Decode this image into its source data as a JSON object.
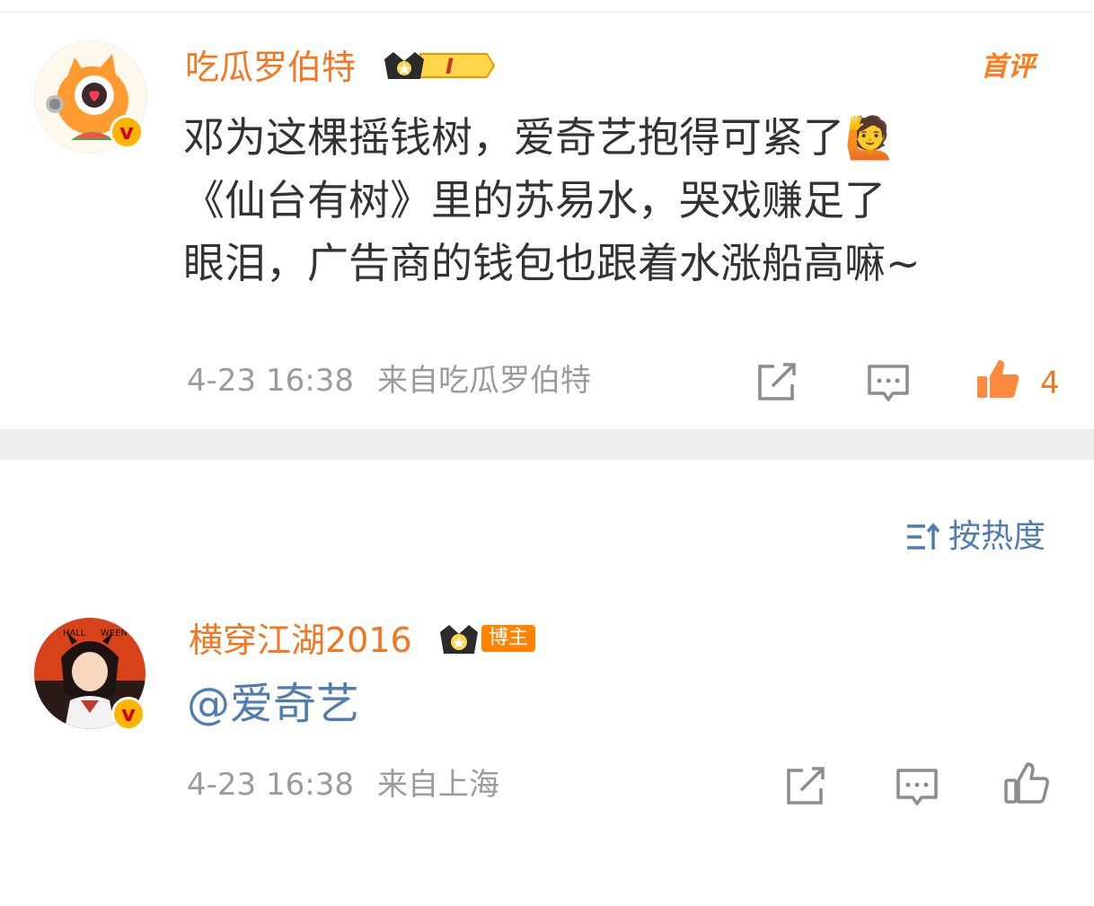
{
  "post": {
    "username": "吃瓜罗伯特",
    "level_badge": "I",
    "first_comment_badge": "首评",
    "content_lines": [
      "邓为这棵摇钱树，爱奇艺抱得可紧了🙋",
      "《仙台有树》里的苏易水，哭戏赚足了",
      "眼泪，广告商的钱包也跟着水涨船高嘛~"
    ],
    "timestamp": "4-23 16:38",
    "source": "来自吃瓜罗伯特",
    "like_count": "4",
    "colors": {
      "username": "#f37621",
      "like_active": "#f37621",
      "verified": "#ffb400"
    }
  },
  "sort": {
    "label": "按热度",
    "icon": "sort-icon"
  },
  "comment": {
    "username": "横穿江湖2016",
    "role_tag": "博主",
    "content": "@爱奇艺",
    "timestamp": "4-23 16:38",
    "source": "来自上海",
    "colors": {
      "username": "#f37621",
      "mention": "#507daf"
    }
  }
}
